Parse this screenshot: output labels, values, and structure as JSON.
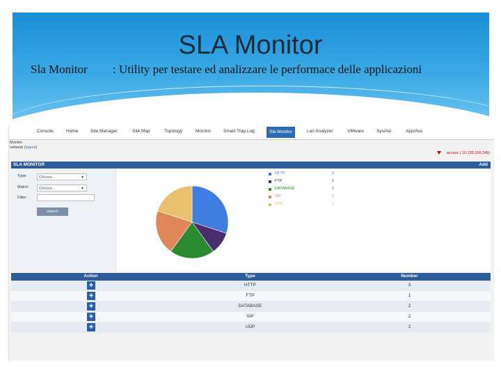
{
  "slide": {
    "title": "SLA Monitor",
    "subtitle_left": "Sla Monitor",
    "subtitle_right": ": Utility per testare ed analizzare le performace delle applicazioni"
  },
  "app": {
    "nav": [
      "Console",
      "Home",
      "Site Manager",
      "Site Map",
      "Topology",
      "Monitor",
      "Smart Trap Log",
      "Sla Monitor",
      "Lan Analyzer",
      "VMware",
      "Sys/Ad",
      "App/Ass"
    ],
    "active_tab": "Sla Monitor",
    "breadcrumb_1": "Monitor",
    "breadcrumb_2_prefix": "network (",
    "breadcrumb_2_link": "logout",
    "breadcrumb_2_suffix": ")",
    "access_text": "access  (  10.135.159.245)",
    "panel_title": "SLA MONITOR",
    "add_label": "Add",
    "filters": {
      "type_label": "Type:",
      "type_value": "Choose...",
      "match_label": "Match:",
      "match_value": "Choose...",
      "filter_label": "Filter:",
      "filter_value": "",
      "search_label": "search"
    },
    "legend_colors": [
      "#3f7de0",
      "#4a2d6e",
      "#2a8a32",
      "#e0875a",
      "#e8c070"
    ],
    "table": {
      "headers": [
        "Action",
        "Type",
        "Number"
      ],
      "rows": [
        {
          "type": "HTTP",
          "number": "3"
        },
        {
          "type": "FTP",
          "number": "1"
        },
        {
          "type": "DATABASE",
          "number": "2"
        },
        {
          "type": "SIP",
          "number": "2"
        },
        {
          "type": "UDP",
          "number": "2"
        }
      ]
    }
  },
  "chart_data": {
    "type": "pie",
    "categories": [
      "HTTP",
      "FTP",
      "DATABASE",
      "SIP",
      "UDP"
    ],
    "values": [
      3,
      1,
      2,
      2,
      2
    ],
    "colors": [
      "#3f7de0",
      "#4a2d6e",
      "#2a8a32",
      "#e0875a",
      "#e8c070"
    ],
    "legend_position": "right"
  }
}
